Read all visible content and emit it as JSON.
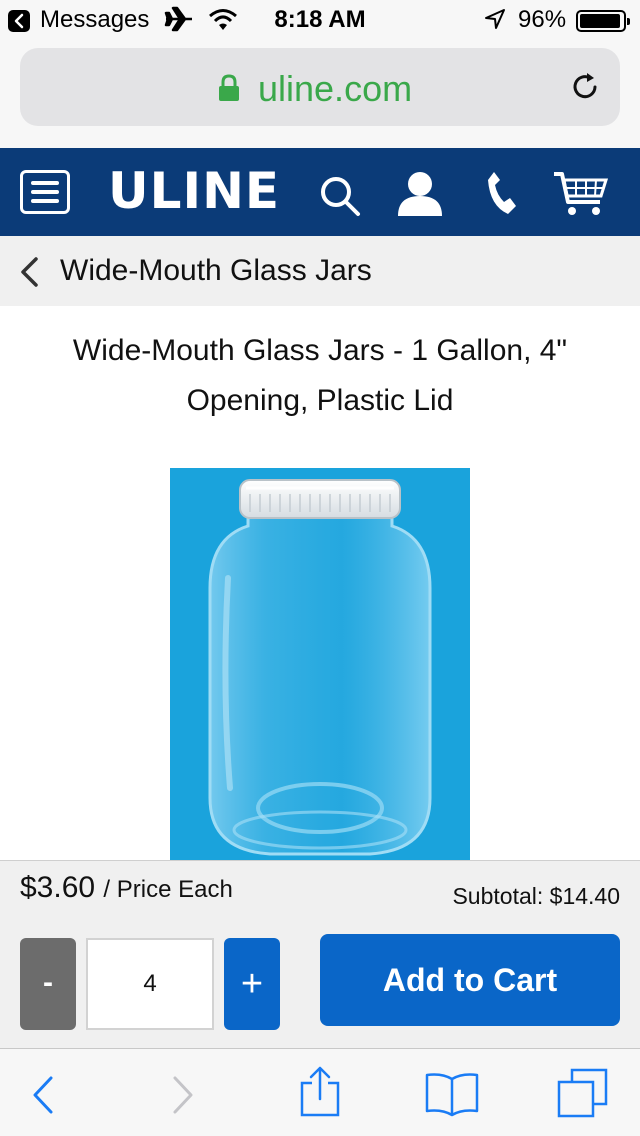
{
  "status_bar": {
    "back_app": "Messages",
    "time": "8:18 AM",
    "battery": "96%",
    "battery_level": 0.96
  },
  "browser": {
    "url": "uline.com"
  },
  "header": {
    "logo": "ULINE",
    "icons": [
      "menu-icon",
      "search-icon",
      "account-icon",
      "phone-icon",
      "cart-icon"
    ],
    "brand_color": "#0b3b78"
  },
  "breadcrumb": {
    "label": "Wide-Mouth Glass Jars"
  },
  "product": {
    "title": "Wide-Mouth Glass Jars - 1 Gallon, 4\" Opening, Plastic Lid",
    "image_background": "#1aa3dc"
  },
  "purchase": {
    "price": "$3.60",
    "price_unit": "/ Price Each",
    "subtotal": "Subtotal: $14.40",
    "minus_label": "-",
    "quantity": "4",
    "plus_label": "+",
    "add_to_cart_label": "Add to Cart",
    "accent_color": "#0a66c8"
  },
  "toolbar": {
    "icons": [
      "back-icon",
      "forward-icon",
      "share-icon",
      "bookmarks-icon",
      "tabs-icon"
    ]
  }
}
